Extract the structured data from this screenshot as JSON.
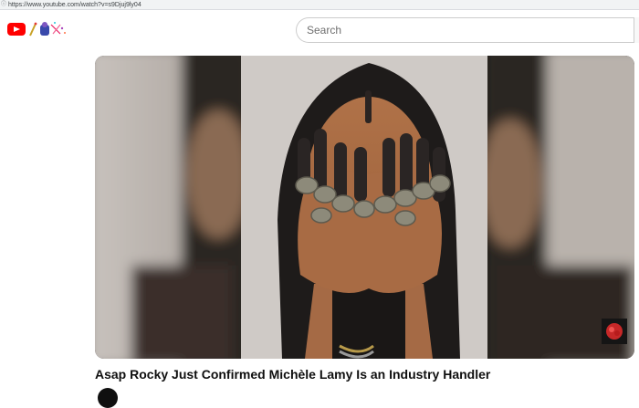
{
  "browser": {
    "url": "https://www.youtube.com/watch?v=s9Djuj9ly04"
  },
  "masthead": {
    "logo_icon": "youtube-logo-icon",
    "doodle_icon": "doodle-decoration-icon",
    "search": {
      "placeholder": "Search",
      "value": ""
    }
  },
  "video": {
    "title": "Asap Rocky Just Confirmed Michèle Lamy Is an Industry Handler",
    "watermark_icon": "channel-watermark-icon"
  },
  "colors": {
    "brand_red": "#ff0000",
    "title_text": "#0f0f0f"
  }
}
